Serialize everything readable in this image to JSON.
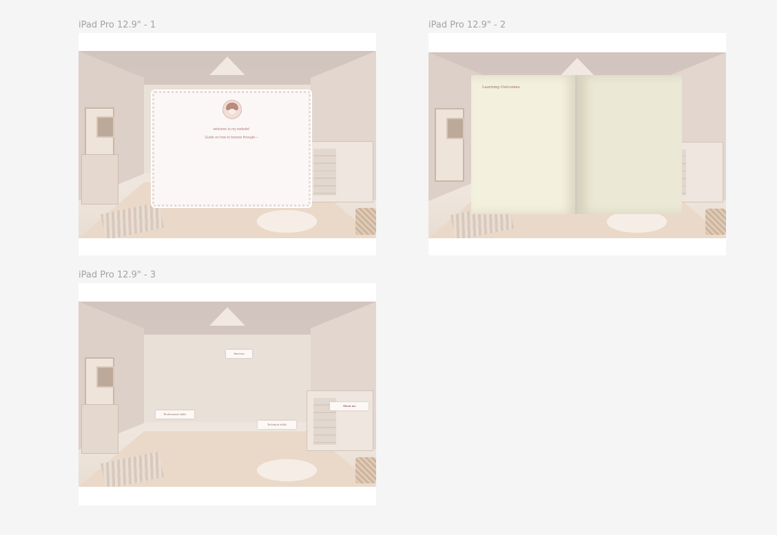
{
  "frames": [
    {
      "label": "iPad Pro 12.9\" - 1"
    },
    {
      "label": "iPad Pro 12.9\" - 2"
    },
    {
      "label": "iPad Pro 12.9\" - 3"
    }
  ],
  "welcome_dialog": {
    "line1": "welcome to my website!",
    "line2": "Guide on how to browse through—"
  },
  "book": {
    "heading": "Learning Outcomes"
  },
  "room_tags": {
    "interests": "Interests",
    "professional_skills": "Professional skills",
    "technical_skills": "Technical skills",
    "about_me": "About me"
  }
}
